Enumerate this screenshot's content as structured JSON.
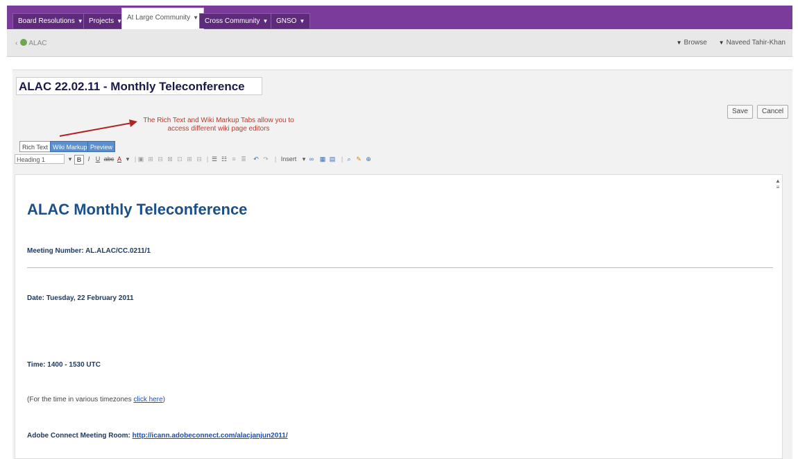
{
  "nav": {
    "tabs": [
      {
        "label": "Board Resolutions",
        "caret": "▼"
      },
      {
        "label": "Projects",
        "caret": "▼"
      },
      {
        "label": "At Large Community",
        "caret": "▼"
      },
      {
        "label": "Cross Community",
        "caret": "▼"
      },
      {
        "label": "GNSO",
        "caret": "▼"
      }
    ]
  },
  "breadcrumb": {
    "back": "‹",
    "label": "ALAC"
  },
  "header_links": {
    "browse": "Browse",
    "user": "Naveed Tahir-Khan",
    "tri": "▼"
  },
  "page": {
    "title_value": "ALAC 22.02.11 - Monthly Teleconference",
    "save": "Save",
    "cancel": "Cancel"
  },
  "annotation": "The Rich Text and Wiki Markup Tabs allow you to access different wiki page editors",
  "editor_tabs": [
    "Rich Text",
    "Wiki Markup",
    "Preview"
  ],
  "toolbar": {
    "heading_select": "Heading 1",
    "bold": "B",
    "italic": "I",
    "underline": "U",
    "strike": "abc",
    "color": "A",
    "insert": "Insert"
  },
  "content": {
    "heading": "ALAC Monthly Teleconference",
    "meeting_number": "Meeting Number: AL.ALAC/CC.0211/1",
    "date": "Date: Tuesday, 22 February 2011",
    "time": "Time: 1400 - 1530 UTC",
    "timezone_prefix": "(For the time in various timezones ",
    "timezone_link": "click here",
    "timezone_suffix": ")",
    "adobe_label": "Adobe Connect Meeting Room: ",
    "adobe_link": "http://icann.adobeconnect.com/alacjanjun2011/"
  }
}
